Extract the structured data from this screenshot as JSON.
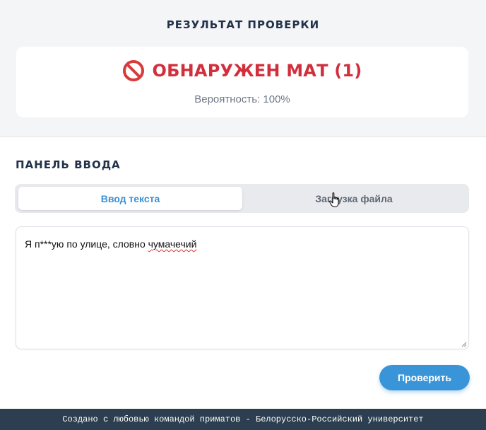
{
  "result": {
    "heading": "РЕЗУЛЬТАТ ПРОВЕРКИ",
    "icon": "prohibited-icon",
    "title": "ОБНАРУЖЕН МАТ (1)",
    "probability": "Вероятность: 100%",
    "status_color": "#d12f3c"
  },
  "input_panel": {
    "heading": "ПАНЕЛЬ ВВОДА",
    "tabs": [
      {
        "label": "Ввод текста",
        "active": true
      },
      {
        "label": "Загрузка файла",
        "active": false
      }
    ],
    "text_before": "Я п***ую по улице, словно ",
    "text_misspelled": "чумачечий",
    "check_button": "Проверить",
    "accent_color": "#3a95d8"
  },
  "footer": {
    "text": "Создано с любовью командой приматов - Белорусско-Российский университет"
  }
}
